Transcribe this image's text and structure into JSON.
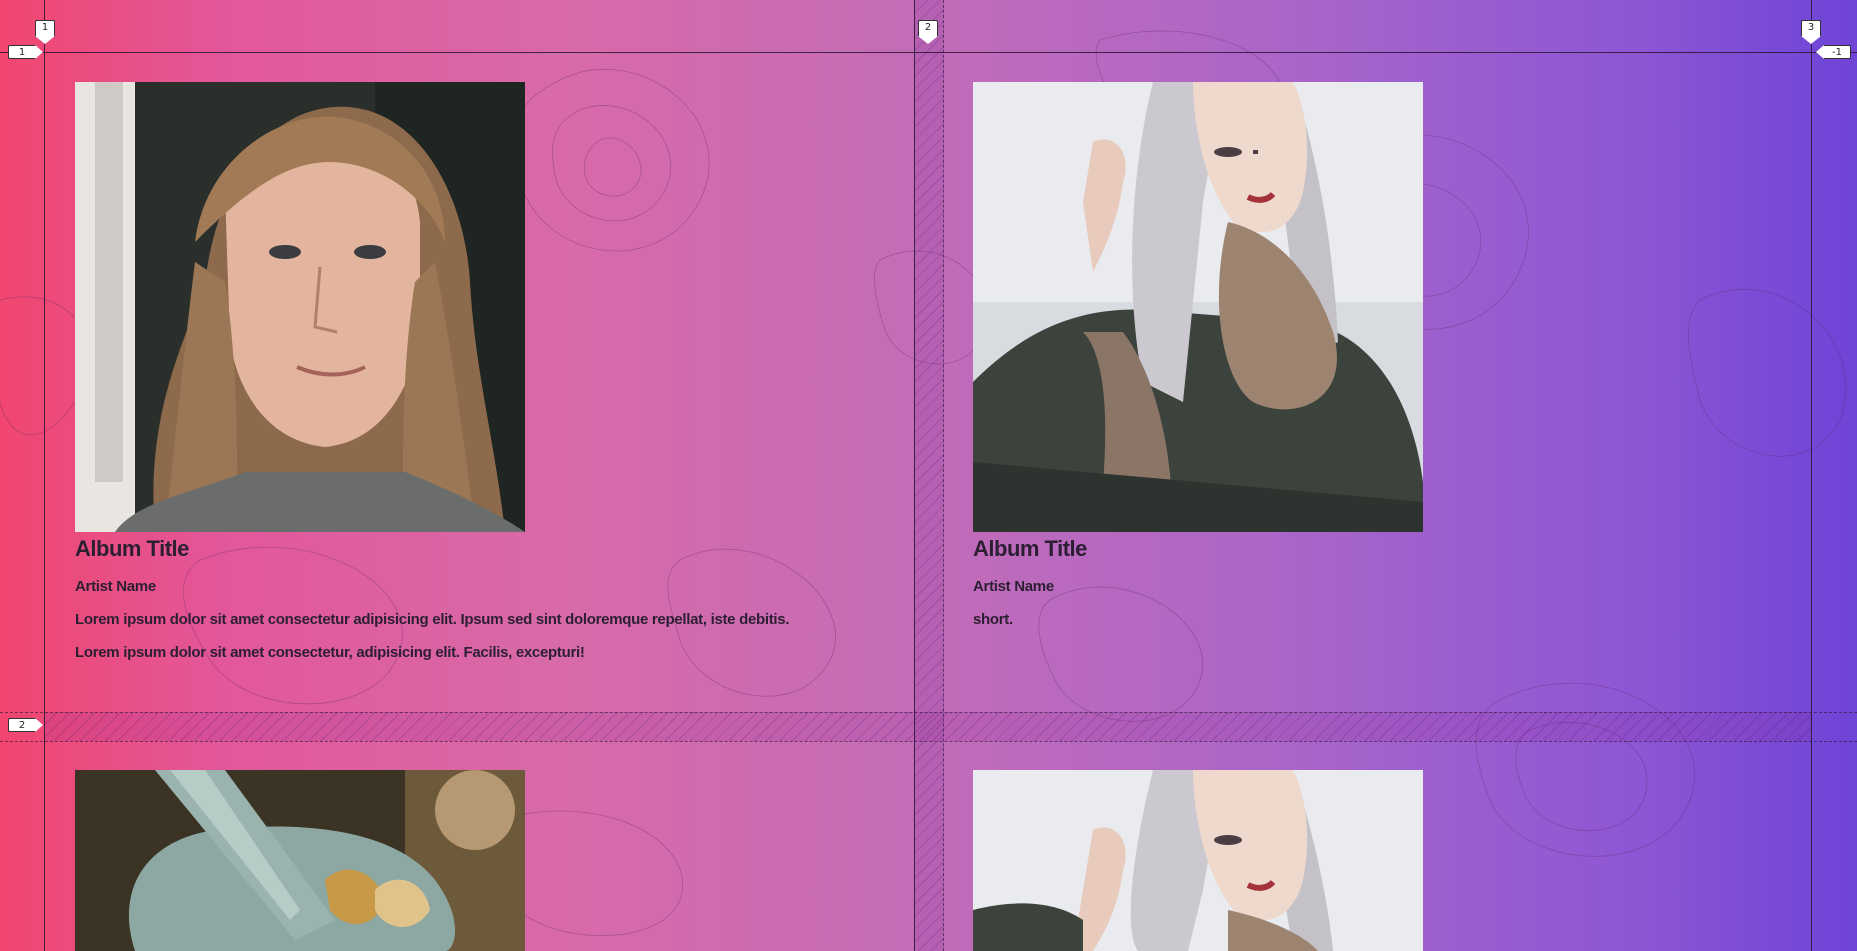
{
  "grid_labels": {
    "col_1": "1",
    "col_2": "2",
    "col_3": "3",
    "row_1": "1",
    "row_2": "2",
    "row_end": "-1"
  },
  "cards": [
    {
      "title": "Album Title",
      "artist": "Artist Name",
      "descriptions": [
        "Lorem ipsum dolor sit amet consectetur adipisicing elit. Ipsum sed sint doloremque repellat, iste debitis.",
        "Lorem ipsum dolor sit amet consectetur, adipisicing elit. Facilis, excepturi!"
      ],
      "image": "portrait-woman-blonde"
    },
    {
      "title": "Album Title",
      "artist": "Artist Name",
      "descriptions": [
        "short."
      ],
      "image": "portrait-woman-fur-jacket"
    },
    {
      "title": "",
      "artist": "",
      "descriptions": [],
      "image": "mortar-and-pestle"
    },
    {
      "title": "",
      "artist": "",
      "descriptions": [],
      "image": "portrait-woman-fur-jacket"
    }
  ],
  "colors": {
    "gradient_start": "#f0466f",
    "gradient_end": "#6e44d6",
    "text": "#2d1f33"
  }
}
